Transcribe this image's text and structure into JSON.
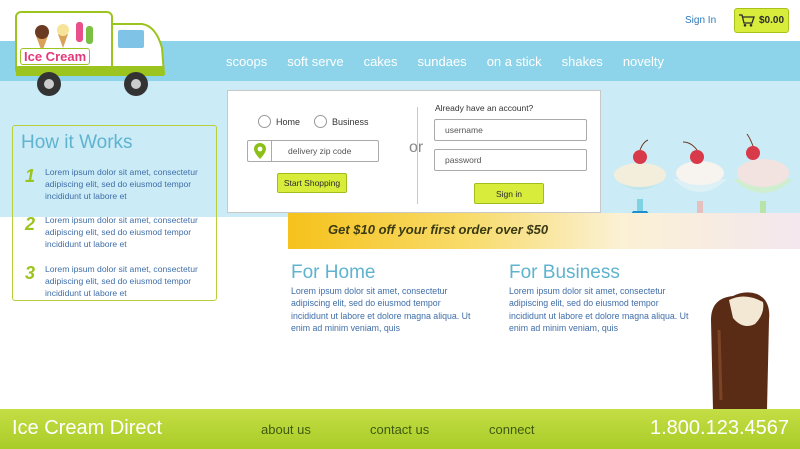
{
  "header": {
    "logo_text": "Ice Cream",
    "signin_label": "Sign In",
    "cart_total": "$0.00"
  },
  "nav": {
    "items": [
      "scoops",
      "soft serve",
      "cakes",
      "sundaes",
      "on a stick",
      "shakes",
      "novelty"
    ]
  },
  "how_it_works": {
    "title": "How it Works",
    "steps": [
      {
        "num": "1",
        "text": "Lorem ipsum dolor sit amet, consectetur adipiscing elit, sed do eiusmod tempor incididunt ut labore et"
      },
      {
        "num": "2",
        "text": "Lorem ipsum dolor sit amet, consectetur adipiscing elit, sed do eiusmod tempor incididunt ut labore et"
      },
      {
        "num": "3",
        "text": "Lorem ipsum dolor sit amet, consectetur adipiscing elit, sed do eiusmod tempor incididunt ut labore et"
      }
    ]
  },
  "shop": {
    "radio_home": "Home",
    "radio_business": "Business",
    "zip_placeholder": "delivery zip code",
    "start_label": "Start Shopping",
    "or_text": "or"
  },
  "login": {
    "heading": "Already have an account?",
    "username_placeholder": "username",
    "password_placeholder": "password",
    "signin_button": "Sign in"
  },
  "promo": {
    "text": "Get $10 off your first order over $50"
  },
  "sections": {
    "home_title": "For Home",
    "home_text": "Lorem ipsum dolor sit amet, consectetur adipiscing elit, sed do eiusmod tempor incididunt ut labore et dolore magna aliqua. Ut enim ad minim veniam, quis",
    "business_title": "For Business",
    "business_text": "Lorem ipsum dolor sit amet, consectetur adipiscing elit, sed do eiusmod tempor incididunt ut labore et dolore magna aliqua. Ut enim ad minim veniam, quis"
  },
  "footer": {
    "brand": "Ice Cream Direct",
    "about": "about us",
    "contact": "contact us",
    "connect": "connect",
    "phone": "1.800.123.4567"
  },
  "colors": {
    "nav_blue": "#8dd4ea",
    "accent_green": "#d8ec3c",
    "footer_green": "#b3d332",
    "heading_blue": "#5fb3cf"
  }
}
